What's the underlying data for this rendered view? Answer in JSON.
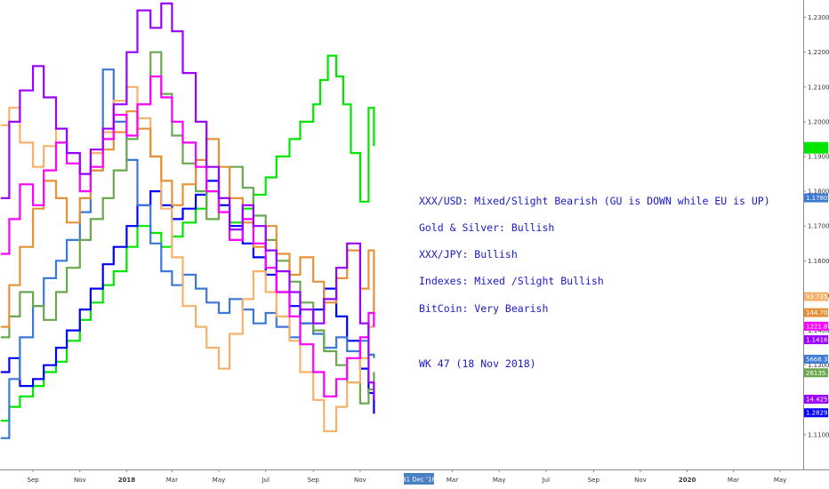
{
  "chart_data": {
    "type": "line",
    "title": "",
    "xlabel": "",
    "ylabel": "",
    "grid": false,
    "y_axis": {
      "position": "right",
      "range": [
        1.1,
        1.235
      ],
      "ticks": [
        "1.23000",
        "1.22000",
        "1.21000",
        "1.20000",
        "1.19000",
        "1.18000",
        "1.17000",
        "1.16000",
        "1.15000",
        "1.14000",
        "1.13000",
        "1.12000",
        "1.11000"
      ]
    },
    "x_axis": {
      "range": [
        "2017-07-20",
        "2020-05-31"
      ],
      "ticks": [
        {
          "label": "Sep",
          "date": "2017-09-01",
          "bold": false
        },
        {
          "label": "Nov",
          "date": "2017-11-01",
          "bold": false
        },
        {
          "label": "2018",
          "date": "2018-01-01",
          "bold": true
        },
        {
          "label": "Mar",
          "date": "2018-03-01",
          "bold": false
        },
        {
          "label": "May",
          "date": "2018-05-01",
          "bold": false
        },
        {
          "label": "Jul",
          "date": "2018-07-01",
          "bold": false
        },
        {
          "label": "Sep",
          "date": "2018-09-01",
          "bold": false
        },
        {
          "label": "Nov",
          "date": "2018-11-01",
          "bold": false
        },
        {
          "label": "Mar",
          "date": "2019-03-01",
          "bold": false
        },
        {
          "label": "May",
          "date": "2019-05-01",
          "bold": false
        },
        {
          "label": "Jul",
          "date": "2019-07-01",
          "bold": false
        },
        {
          "label": "Sep",
          "date": "2019-09-01",
          "bold": false
        },
        {
          "label": "Nov",
          "date": "2019-11-01",
          "bold": false
        },
        {
          "label": "2020",
          "date": "2020-01-01",
          "bold": true
        },
        {
          "label": "Mar",
          "date": "2020-03-01",
          "bold": false
        },
        {
          "label": "May",
          "date": "2020-05-01",
          "bold": false
        }
      ],
      "cursor_label": "31 Dec '18",
      "cursor_date": "2018-12-31"
    },
    "annotations": [
      "XXX/USD: Mixed/Slight Bearish (GU is DOWN while EU is UP)",
      "Gold & Silver: Bullish",
      "XXX/JPY: Bullish",
      "Indexes: Mixed /Slight Bullish",
      "BitCoin: Very Bearish",
      "WK 47 (18 Nov 2018)"
    ],
    "price_tags": [
      {
        "label": "",
        "value": 1.1925,
        "color": "#00e600"
      },
      {
        "label": "1.17806",
        "value": 1.1781,
        "color": "#3c78d8"
      },
      {
        "label": "92.725",
        "value": 1.1497,
        "color": "#f6b26b"
      },
      {
        "label": "144.708",
        "value": 1.1451,
        "color": "#e69138"
      },
      {
        "label": "1221.811",
        "value": 1.1412,
        "color": "#ff00ff"
      },
      {
        "label": "1.14161",
        "value": 1.1373,
        "color": "#9900ff"
      },
      {
        "label": "5666.3",
        "value": 1.1317,
        "color": "#3c78d8"
      },
      {
        "label": "26135.1",
        "value": 1.1278,
        "color": "#6aa84f"
      },
      {
        "label": "14.42500",
        "value": 1.1202,
        "color": "#9900ff"
      },
      {
        "label": "1.28290",
        "value": 1.1163,
        "color": "#0000ff"
      }
    ],
    "series": [
      {
        "color": "#00e600",
        "x": [
          "2017-07-21",
          "2017-08-01",
          "2017-08-15",
          "2017-09-01",
          "2017-09-15",
          "2017-10-01",
          "2017-10-15",
          "2017-11-01",
          "2017-11-15",
          "2017-12-01",
          "2017-12-15",
          "2018-01-01",
          "2018-01-15",
          "2018-02-01",
          "2018-02-15",
          "2018-03-01",
          "2018-03-15",
          "2018-04-01",
          "2018-04-15",
          "2018-05-01",
          "2018-05-15",
          "2018-06-01",
          "2018-06-15",
          "2018-07-01",
          "2018-07-15",
          "2018-08-01",
          "2018-08-15",
          "2018-09-01",
          "2018-09-10",
          "2018-09-20",
          "2018-10-01",
          "2018-10-10",
          "2018-10-20",
          "2018-11-01",
          "2018-11-12",
          "2018-11-19"
        ],
        "y": [
          1.114,
          1.118,
          1.121,
          1.124,
          1.128,
          1.131,
          1.137,
          1.143,
          1.148,
          1.153,
          1.157,
          1.164,
          1.17,
          1.168,
          1.164,
          1.167,
          1.171,
          1.175,
          1.18,
          1.176,
          1.171,
          1.175,
          1.179,
          1.184,
          1.19,
          1.195,
          1.2,
          1.205,
          1.212,
          1.219,
          1.213,
          1.205,
          1.191,
          1.177,
          1.204,
          1.193
        ]
      },
      {
        "color": "#0000ff",
        "x": [
          "2017-07-21",
          "2017-08-01",
          "2017-08-15",
          "2017-09-01",
          "2017-09-15",
          "2017-10-01",
          "2017-10-15",
          "2017-11-01",
          "2017-11-15",
          "2017-12-01",
          "2017-12-15",
          "2018-01-01",
          "2018-01-15",
          "2018-02-01",
          "2018-02-15",
          "2018-03-01",
          "2018-03-15",
          "2018-04-01",
          "2018-04-15",
          "2018-05-01",
          "2018-05-15",
          "2018-06-01",
          "2018-06-15",
          "2018-07-01",
          "2018-07-15",
          "2018-08-01",
          "2018-08-15",
          "2018-09-01",
          "2018-09-15",
          "2018-10-01",
          "2018-10-15",
          "2018-11-01",
          "2018-11-12",
          "2018-11-19"
        ],
        "y": [
          1.128,
          1.132,
          1.124,
          1.126,
          1.13,
          1.135,
          1.14,
          1.146,
          1.152,
          1.159,
          1.164,
          1.17,
          1.176,
          1.18,
          1.176,
          1.172,
          1.175,
          1.179,
          1.183,
          1.176,
          1.17,
          1.165,
          1.161,
          1.156,
          1.151,
          1.147,
          1.142,
          1.146,
          1.152,
          1.144,
          1.137,
          1.129,
          1.122,
          1.116
        ]
      },
      {
        "color": "#3c78d8",
        "x": [
          "2017-07-21",
          "2017-08-01",
          "2017-08-15",
          "2017-09-01",
          "2017-09-15",
          "2017-10-01",
          "2017-10-15",
          "2017-11-01",
          "2017-11-15",
          "2017-12-01",
          "2017-12-15",
          "2018-01-01",
          "2018-01-15",
          "2018-02-01",
          "2018-02-15",
          "2018-03-01",
          "2018-03-15",
          "2018-04-01",
          "2018-04-15",
          "2018-05-01",
          "2018-05-15",
          "2018-06-01",
          "2018-06-15",
          "2018-07-01",
          "2018-07-15",
          "2018-08-01",
          "2018-08-15",
          "2018-09-01",
          "2018-09-15",
          "2018-10-01",
          "2018-10-15",
          "2018-11-01",
          "2018-11-12",
          "2018-11-19"
        ],
        "y": [
          1.109,
          1.126,
          1.138,
          1.147,
          1.155,
          1.16,
          1.166,
          1.174,
          1.186,
          1.215,
          1.2,
          1.189,
          1.176,
          1.165,
          1.157,
          1.153,
          1.156,
          1.152,
          1.148,
          1.145,
          1.149,
          1.146,
          1.142,
          1.145,
          1.141,
          1.138,
          1.142,
          1.139,
          1.135,
          1.138,
          1.134,
          1.137,
          1.133,
          1.132
        ]
      },
      {
        "color": "#6aa84f",
        "x": [
          "2017-07-21",
          "2017-08-01",
          "2017-08-15",
          "2017-09-01",
          "2017-09-15",
          "2017-10-01",
          "2017-10-15",
          "2017-11-01",
          "2017-11-15",
          "2017-12-01",
          "2017-12-15",
          "2018-01-01",
          "2018-01-15",
          "2018-02-01",
          "2018-02-15",
          "2018-03-01",
          "2018-03-15",
          "2018-04-01",
          "2018-04-15",
          "2018-05-01",
          "2018-05-15",
          "2018-06-01",
          "2018-06-15",
          "2018-07-01",
          "2018-07-15",
          "2018-08-01",
          "2018-08-15",
          "2018-09-01",
          "2018-09-15",
          "2018-10-01",
          "2018-10-15",
          "2018-11-01",
          "2018-11-12",
          "2018-11-19"
        ],
        "y": [
          1.138,
          1.144,
          1.151,
          1.147,
          1.143,
          1.151,
          1.158,
          1.166,
          1.172,
          1.178,
          1.186,
          1.195,
          1.205,
          1.22,
          1.208,
          1.196,
          1.188,
          1.18,
          1.172,
          1.178,
          1.187,
          1.181,
          1.173,
          1.166,
          1.16,
          1.154,
          1.148,
          1.14,
          1.134,
          1.13,
          1.125,
          1.119,
          1.123,
          1.128
        ]
      },
      {
        "color": "#f6b26b",
        "x": [
          "2017-07-21",
          "2017-08-01",
          "2017-08-15",
          "2017-09-01",
          "2017-09-15",
          "2017-10-01",
          "2017-10-15",
          "2017-11-01",
          "2017-11-15",
          "2017-12-01",
          "2017-12-15",
          "2018-01-01",
          "2018-01-15",
          "2018-02-01",
          "2018-02-15",
          "2018-03-01",
          "2018-03-15",
          "2018-04-01",
          "2018-04-15",
          "2018-05-01",
          "2018-05-15",
          "2018-06-01",
          "2018-06-15",
          "2018-07-01",
          "2018-07-15",
          "2018-08-01",
          "2018-08-15",
          "2018-09-01",
          "2018-09-15",
          "2018-10-01",
          "2018-10-15",
          "2018-11-01",
          "2018-11-12",
          "2018-11-19"
        ],
        "y": [
          1.199,
          1.204,
          1.194,
          1.187,
          1.193,
          1.198,
          1.191,
          1.185,
          1.191,
          1.197,
          1.206,
          1.21,
          1.201,
          1.19,
          1.175,
          1.161,
          1.147,
          1.141,
          1.135,
          1.129,
          1.139,
          1.149,
          1.157,
          1.151,
          1.144,
          1.137,
          1.128,
          1.12,
          1.111,
          1.118,
          1.125,
          1.132,
          1.141,
          1.149
        ]
      },
      {
        "color": "#e69138",
        "x": [
          "2017-07-21",
          "2017-08-01",
          "2017-08-15",
          "2017-09-01",
          "2017-09-15",
          "2017-10-01",
          "2017-10-15",
          "2017-11-01",
          "2017-11-15",
          "2017-12-01",
          "2017-12-15",
          "2018-01-01",
          "2018-01-15",
          "2018-02-01",
          "2018-02-15",
          "2018-03-01",
          "2018-03-15",
          "2018-04-01",
          "2018-04-15",
          "2018-05-01",
          "2018-05-15",
          "2018-06-01",
          "2018-06-15",
          "2018-07-01",
          "2018-07-15",
          "2018-08-01",
          "2018-08-15",
          "2018-09-01",
          "2018-09-15",
          "2018-10-01",
          "2018-10-15",
          "2018-11-01",
          "2018-11-12",
          "2018-11-19"
        ],
        "y": [
          1.141,
          1.153,
          1.164,
          1.175,
          1.183,
          1.178,
          1.171,
          1.178,
          1.186,
          1.192,
          1.197,
          1.203,
          1.198,
          1.19,
          1.183,
          1.176,
          1.182,
          1.189,
          1.195,
          1.187,
          1.178,
          1.171,
          1.164,
          1.17,
          1.162,
          1.156,
          1.161,
          1.154,
          1.148,
          1.155,
          1.163,
          1.152,
          1.163,
          1.145
        ]
      },
      {
        "color": "#ff00ff",
        "x": [
          "2017-07-21",
          "2017-08-01",
          "2017-08-15",
          "2017-09-01",
          "2017-09-15",
          "2017-10-01",
          "2017-10-15",
          "2017-11-01",
          "2017-11-15",
          "2017-12-01",
          "2017-12-15",
          "2018-01-01",
          "2018-01-15",
          "2018-02-01",
          "2018-02-15",
          "2018-03-01",
          "2018-03-15",
          "2018-04-01",
          "2018-04-15",
          "2018-05-01",
          "2018-05-15",
          "2018-06-01",
          "2018-06-15",
          "2018-07-01",
          "2018-07-15",
          "2018-08-01",
          "2018-08-15",
          "2018-09-01",
          "2018-09-15",
          "2018-10-01",
          "2018-10-15",
          "2018-11-01",
          "2018-11-12",
          "2018-11-19"
        ],
        "y": [
          1.162,
          1.172,
          1.182,
          1.176,
          1.186,
          1.194,
          1.188,
          1.18,
          1.187,
          1.195,
          1.202,
          1.196,
          1.205,
          1.213,
          1.207,
          1.2,
          1.194,
          1.187,
          1.18,
          1.174,
          1.166,
          1.172,
          1.165,
          1.158,
          1.151,
          1.144,
          1.136,
          1.128,
          1.121,
          1.126,
          1.132,
          1.138,
          1.145,
          1.141
        ]
      },
      {
        "color": "#9900ff",
        "x": [
          "2017-07-21",
          "2017-08-01",
          "2017-08-15",
          "2017-09-01",
          "2017-09-15",
          "2017-10-01",
          "2017-10-15",
          "2017-11-01",
          "2017-11-15",
          "2017-12-01",
          "2017-12-15",
          "2018-01-01",
          "2018-01-15",
          "2018-02-01",
          "2018-02-15",
          "2018-03-01",
          "2018-03-15",
          "2018-04-01",
          "2018-04-15",
          "2018-05-01",
          "2018-05-15",
          "2018-06-01",
          "2018-06-15",
          "2018-07-01",
          "2018-07-15",
          "2018-08-01",
          "2018-08-15",
          "2018-09-01",
          "2018-09-15",
          "2018-10-01",
          "2018-10-15",
          "2018-11-01",
          "2018-11-12",
          "2018-11-19"
        ],
        "y": [
          1.178,
          1.2,
          1.209,
          1.216,
          1.207,
          1.198,
          1.191,
          1.185,
          1.192,
          1.198,
          1.205,
          1.22,
          1.232,
          1.227,
          1.234,
          1.226,
          1.214,
          1.2,
          1.187,
          1.178,
          1.169,
          1.176,
          1.17,
          1.163,
          1.157,
          1.151,
          1.146,
          1.142,
          1.149,
          1.158,
          1.165,
          1.142,
          1.125,
          1.12
        ]
      }
    ]
  }
}
